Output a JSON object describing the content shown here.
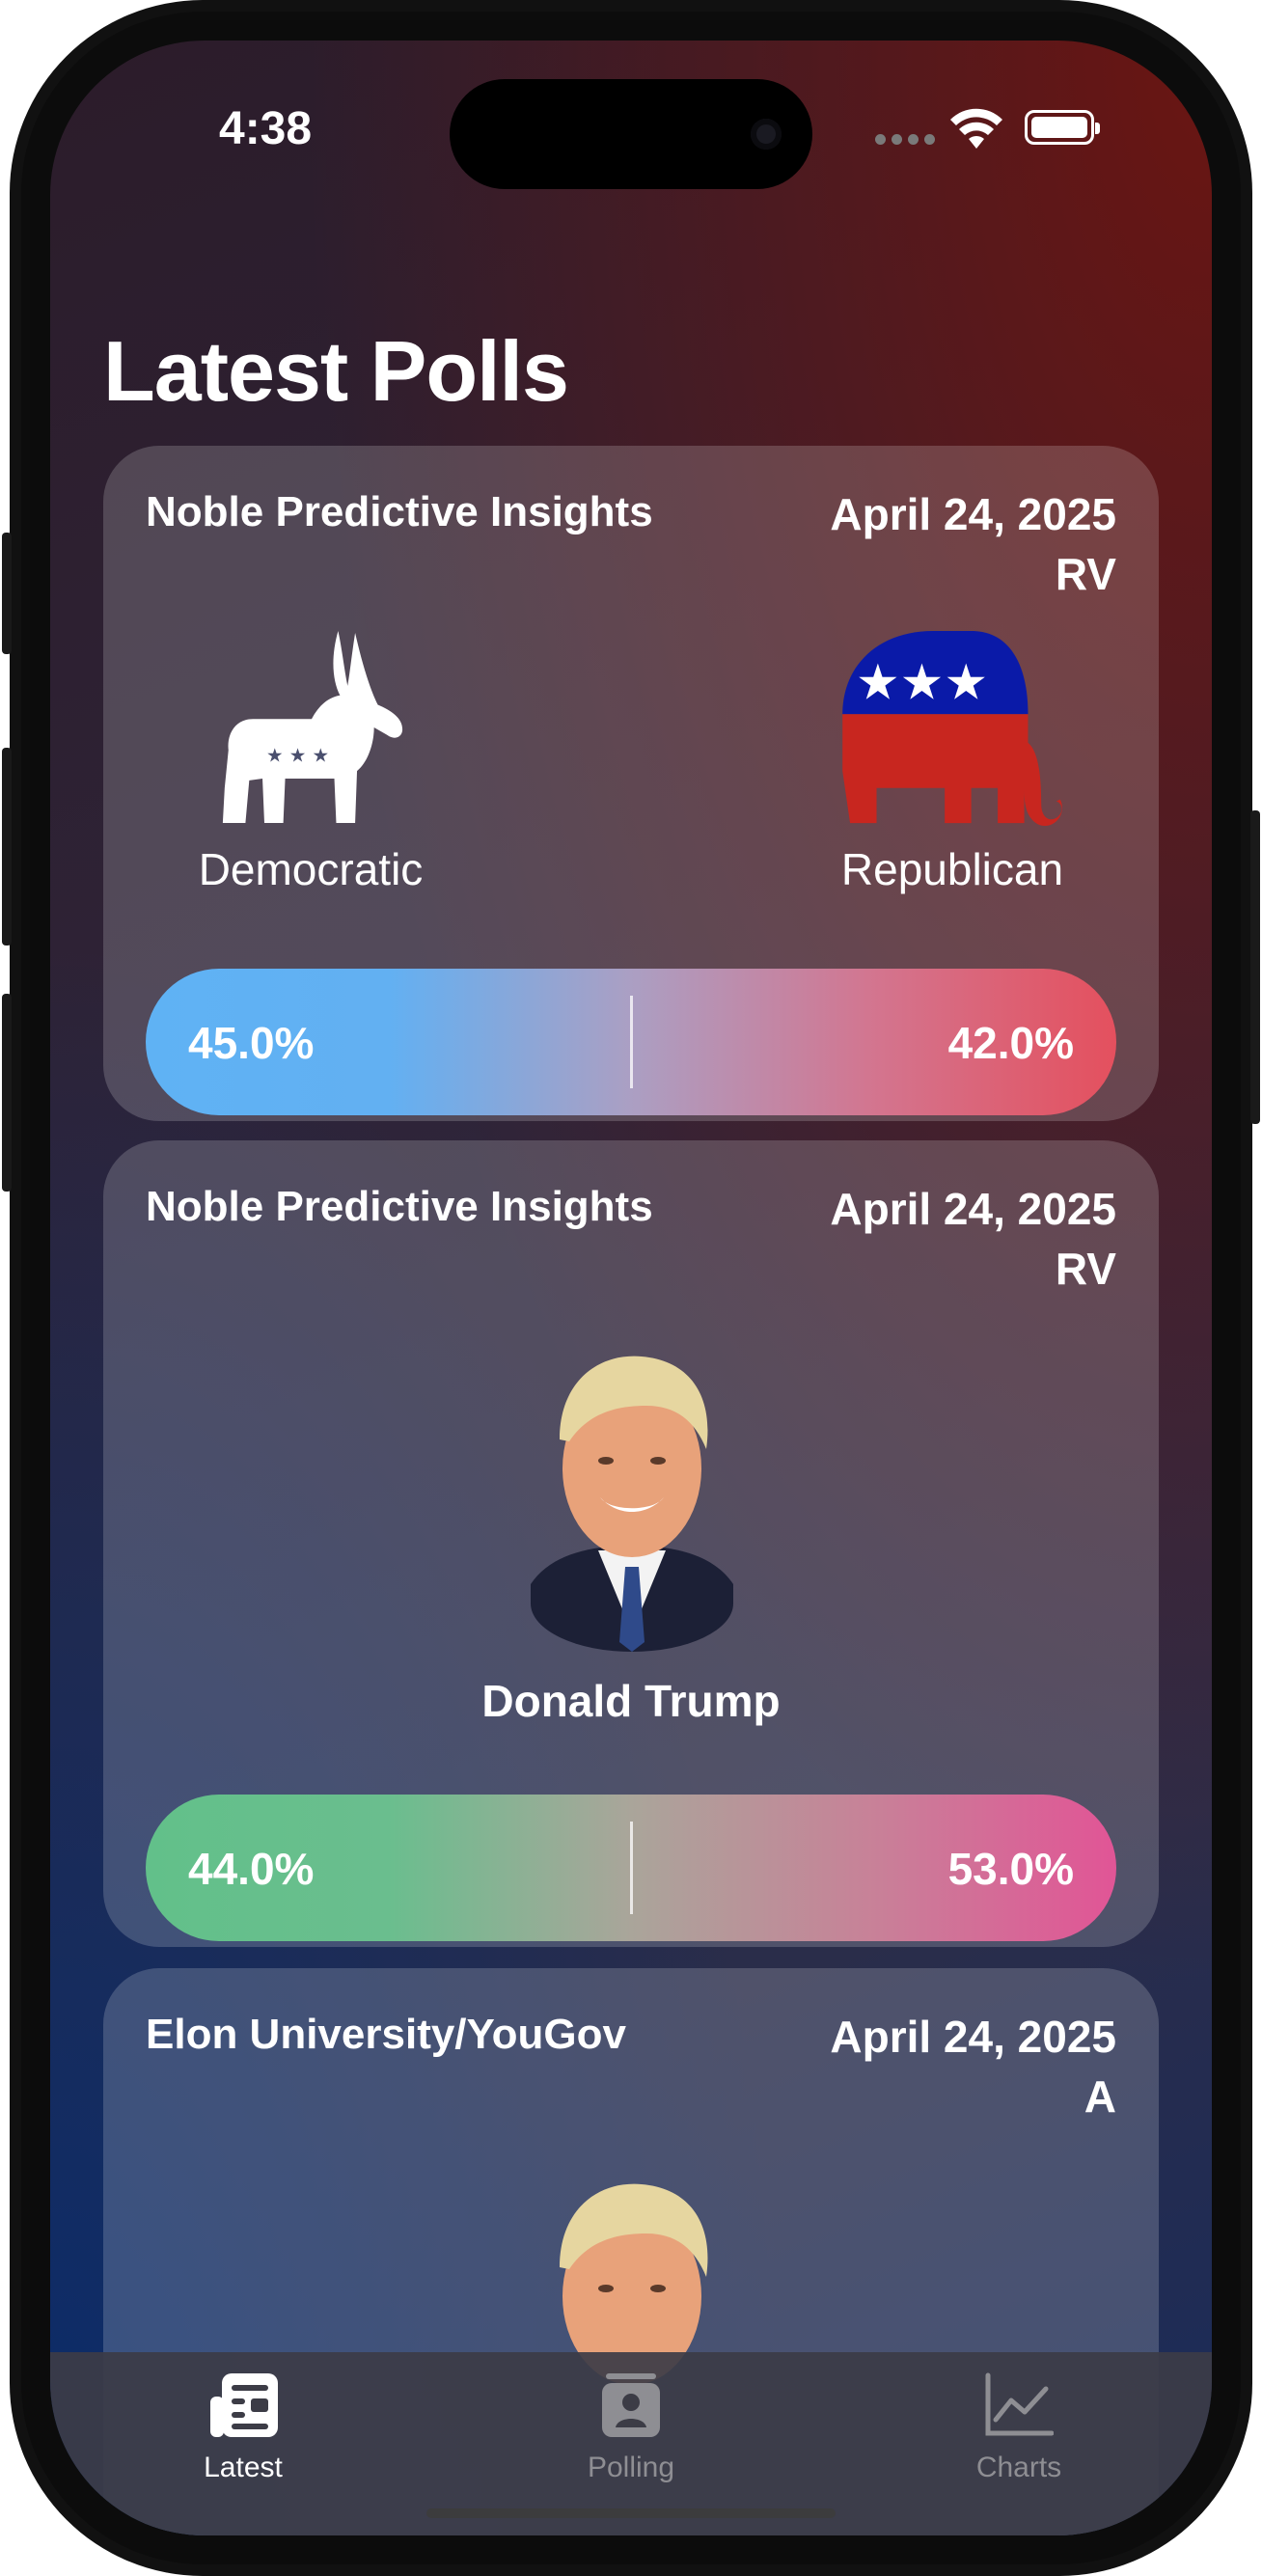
{
  "status": {
    "time": "4:38"
  },
  "page": {
    "title": "Latest Polls"
  },
  "cards": [
    {
      "pollster": "Noble Predictive Insights",
      "date": "April 24, 2025",
      "population": "RV",
      "left_label": "Democratic",
      "right_label": "Republican",
      "left_value": "45.0%",
      "right_value": "42.0%",
      "colors": {
        "left": "#5fb2f4",
        "right": "#e4505e"
      }
    },
    {
      "pollster": "Noble Predictive Insights",
      "date": "April 24, 2025",
      "population": "RV",
      "candidate": "Donald Trump",
      "left_value": "44.0%",
      "right_value": "53.0%",
      "colors": {
        "left": "#62c08a",
        "right": "#e15596"
      }
    },
    {
      "pollster": "Elon University/YouGov",
      "date": "April 24, 2025",
      "population": "A"
    }
  ],
  "tabbar": {
    "tabs": [
      {
        "label": "Latest",
        "icon": "newspaper-icon",
        "active": true
      },
      {
        "label": "Polling",
        "icon": "person-badge-icon",
        "active": false
      },
      {
        "label": "Charts",
        "icon": "line-chart-icon",
        "active": false
      }
    ],
    "active_color": "#ffffff",
    "inactive_color": "#8e8e93"
  }
}
